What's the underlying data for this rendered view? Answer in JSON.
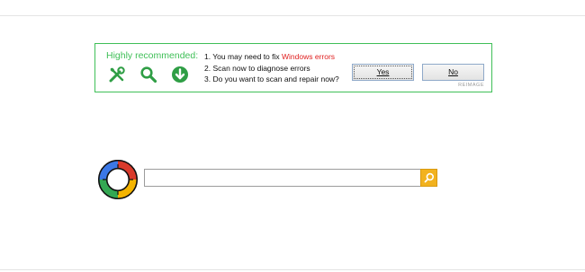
{
  "ad": {
    "heading": "Highly recommended:",
    "icons": [
      "tools-icon",
      "search-icon",
      "download-icon"
    ],
    "lines": {
      "line1_prefix": "1. You may need to fix ",
      "line1_highlight": "Windows errors",
      "line2": "2. Scan now to diagnose errors",
      "line3": "3. Do you want to scan and repair now?"
    },
    "yes_label": "Yes",
    "no_label": "No",
    "brand": "REIMAGE",
    "colors": {
      "accent": "#3fbf57",
      "error": "#e02020"
    }
  },
  "search": {
    "value": "",
    "placeholder": "",
    "button_icon": "search-icon",
    "button_color": "#f2b21e"
  },
  "logo": {
    "icon": "ring-logo-icon",
    "colors": [
      "#d93a2b",
      "#f4b400",
      "#34a853",
      "#3b78e7"
    ]
  }
}
